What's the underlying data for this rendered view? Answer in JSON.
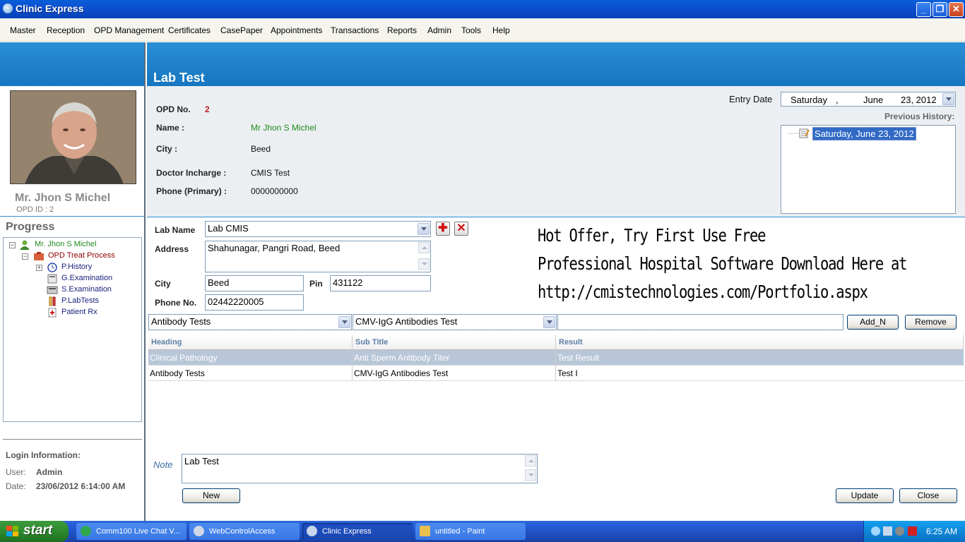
{
  "window": {
    "title": "Clinic Express"
  },
  "menu": [
    "Master",
    "Reception",
    "OPD Management",
    "Certificates",
    "CasePaper",
    "Appointments",
    "Transactions",
    "Reports",
    "Admin",
    "Tools",
    "Help"
  ],
  "patient": {
    "name": "Mr. Jhon S Michel",
    "opd_id": "OPD ID :  2"
  },
  "progress": {
    "title": "Progress",
    "tree": [
      {
        "label": "Mr. Jhon S Michel"
      },
      {
        "label": "OPD Treat Process"
      },
      {
        "label": "P.History"
      },
      {
        "label": "G.Examination"
      },
      {
        "label": "S.Examination"
      },
      {
        "label": "P.LabTests"
      },
      {
        "label": "Patient Rx"
      }
    ]
  },
  "login": {
    "title": "Login Information:",
    "user_label": "User:",
    "user_value": "Admin",
    "date_label": "Date:",
    "date_value": "23/06/2012 6:14:00 AM"
  },
  "page": {
    "title": "Lab Test"
  },
  "info": {
    "opd_label": "OPD No.",
    "opd_value": "2",
    "name_label": "Name :",
    "name_value": "Mr Jhon S Michel",
    "city_label": "City :",
    "city_value": "Beed",
    "doctor_label": "Doctor Incharge :",
    "doctor_value": "CMIS Test",
    "phone_label": "Phone (Primary) :",
    "phone_value": "0000000000"
  },
  "entry_date": {
    "label": "Entry Date",
    "day": "Saturday",
    "sep": ",",
    "month": "June",
    "date": "23, 2012"
  },
  "history": {
    "label": "Previous History:",
    "items": [
      "Saturday, June 23, 2012"
    ]
  },
  "lab": {
    "name_label": "Lab Name",
    "name_value": "Lab CMIS",
    "address_label": "Address",
    "address_value": "Shahunagar, Pangri Road, Beed",
    "city_label": "City",
    "city_value": "Beed",
    "pin_label": "Pin",
    "pin_value": "431122",
    "phone_label": "Phone No.",
    "phone_value": "02442220005"
  },
  "offer": [
    "Hot Offer,  Try First Use Free",
    "Professional Hospital Software Download Here at",
    "http://cmistechnologies.com/Portfolio.aspx"
  ],
  "test_select": {
    "heading": "Antibody Tests",
    "subtitle": "CMV-IgG Antibodies Test",
    "result": "",
    "add_label": "Add_N",
    "remove_label": "Remove"
  },
  "grid": {
    "columns": [
      "Heading",
      "Sub Title",
      "Result"
    ],
    "rows": [
      [
        "Clinical Pathology",
        "Anti Sperm Antibody Titer",
        "Test Result"
      ],
      [
        "Antibody Tests",
        "CMV-IgG Antibodies Test",
        "Test I"
      ]
    ]
  },
  "note": {
    "label": "Note",
    "value": "Lab Test"
  },
  "buttons": {
    "new": "New",
    "update": "Update",
    "close": "Close"
  },
  "taskbar": {
    "start": "start",
    "tasks": [
      "Comm100 Live Chat V...",
      "WebControlAccess",
      "Clinic Express",
      "untitled - Paint"
    ],
    "clock": "6:25 AM"
  }
}
